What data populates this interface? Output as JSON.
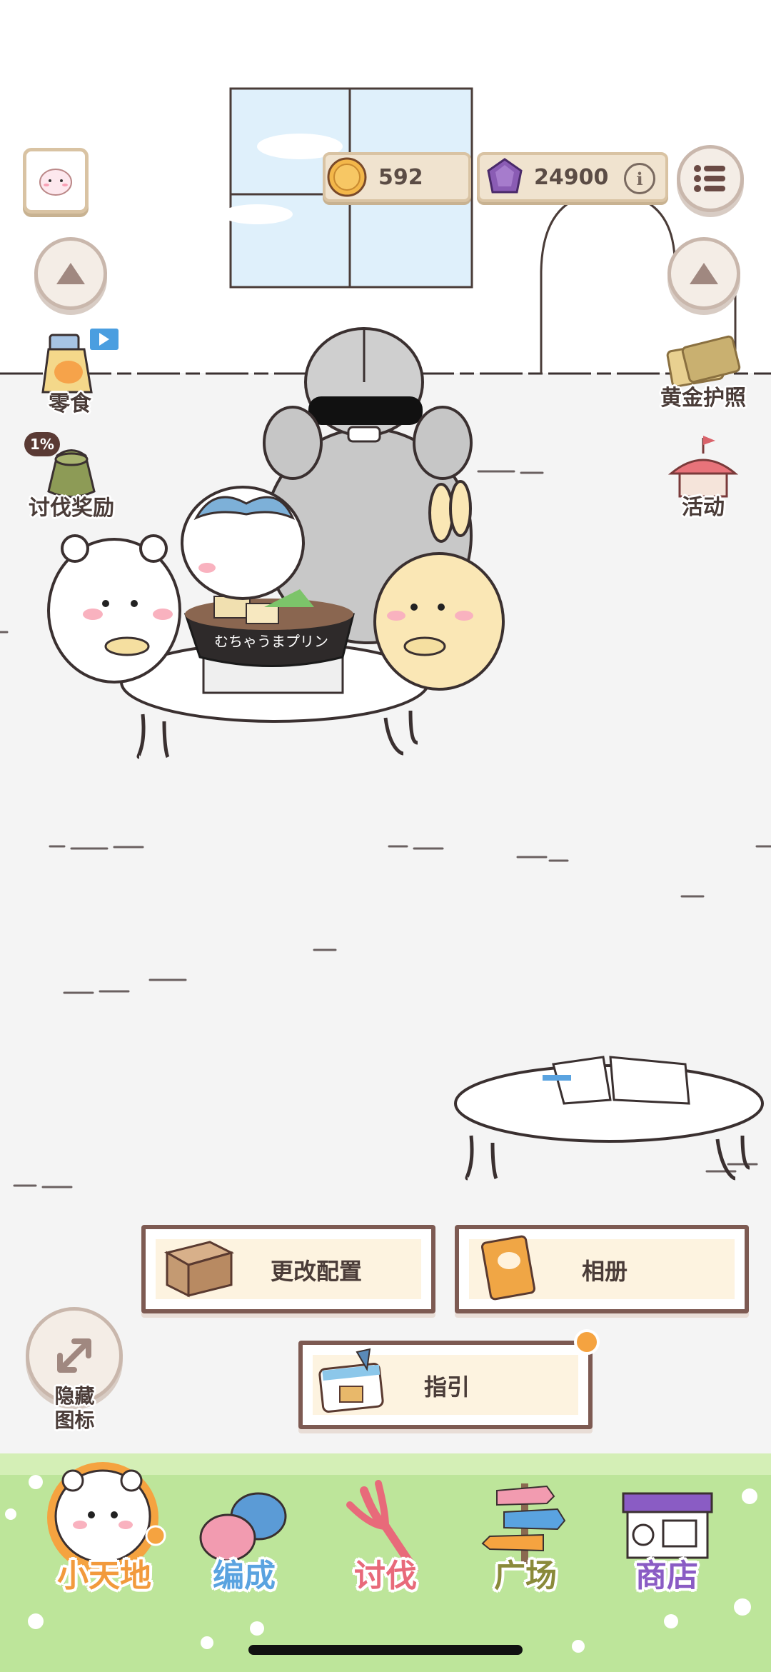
{
  "currency": {
    "coins": "592",
    "gems": "24900"
  },
  "side_left": {
    "snack_label": "零食",
    "reward_label": "讨伐奖励",
    "reward_badge": "1%"
  },
  "side_right": {
    "passport_label": "黄金护照",
    "event_label": "活动"
  },
  "scene": {
    "pot_text": "むちゃうまプリン"
  },
  "actions": {
    "change_layout": "更改配置",
    "album": "相册",
    "guide": "指引",
    "hide_icons": "隐藏\n图标"
  },
  "nav": [
    {
      "label": "小天地",
      "color": "#f29a3c"
    },
    {
      "label": "编成",
      "color": "#5aa3e0"
    },
    {
      "label": "讨伐",
      "color": "#e86a7a"
    },
    {
      "label": "广场",
      "color": "#8a8a3a"
    },
    {
      "label": "商店",
      "color": "#8a5cc4"
    }
  ],
  "colors": {
    "accent_orange": "#f5a340",
    "border_brown": "#7d5a52",
    "panel_cream": "#fdf3e0",
    "grass_green": "#bde59a"
  }
}
